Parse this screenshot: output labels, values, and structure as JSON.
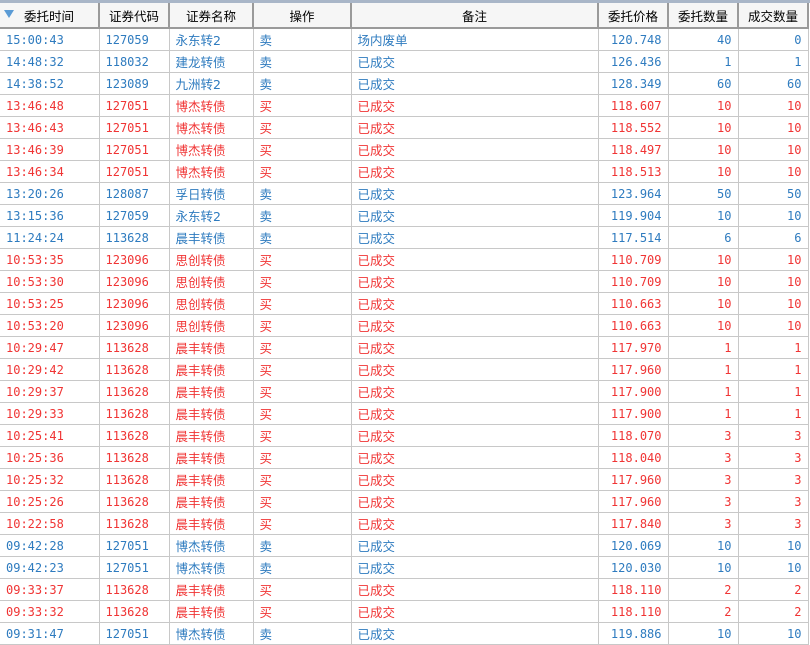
{
  "colors": {
    "sell": "#2e7bbf",
    "buy": "#f03434"
  },
  "headers": [
    "委托时间",
    "证券代码",
    "证券名称",
    "操作",
    "备注",
    "委托价格",
    "委托数量",
    "成交数量"
  ],
  "rows": [
    [
      "15:00:43",
      "127059",
      "永东转2",
      "卖",
      "场内废单",
      "120.748",
      "40",
      "0",
      "sell"
    ],
    [
      "14:48:32",
      "118032",
      "建龙转债",
      "卖",
      "已成交",
      "126.436",
      "1",
      "1",
      "sell"
    ],
    [
      "14:38:52",
      "123089",
      "九洲转2",
      "卖",
      "已成交",
      "128.349",
      "60",
      "60",
      "sell"
    ],
    [
      "13:46:48",
      "127051",
      "博杰转债",
      "买",
      "已成交",
      "118.607",
      "10",
      "10",
      "buy"
    ],
    [
      "13:46:43",
      "127051",
      "博杰转债",
      "买",
      "已成交",
      "118.552",
      "10",
      "10",
      "buy"
    ],
    [
      "13:46:39",
      "127051",
      "博杰转债",
      "买",
      "已成交",
      "118.497",
      "10",
      "10",
      "buy"
    ],
    [
      "13:46:34",
      "127051",
      "博杰转债",
      "买",
      "已成交",
      "118.513",
      "10",
      "10",
      "buy"
    ],
    [
      "13:20:26",
      "128087",
      "孚日转债",
      "卖",
      "已成交",
      "123.964",
      "50",
      "50",
      "sell"
    ],
    [
      "13:15:36",
      "127059",
      "永东转2",
      "卖",
      "已成交",
      "119.904",
      "10",
      "10",
      "sell"
    ],
    [
      "11:24:24",
      "113628",
      "晨丰转债",
      "卖",
      "已成交",
      "117.514",
      "6",
      "6",
      "sell"
    ],
    [
      "10:53:35",
      "123096",
      "思创转债",
      "买",
      "已成交",
      "110.709",
      "10",
      "10",
      "buy"
    ],
    [
      "10:53:30",
      "123096",
      "思创转债",
      "买",
      "已成交",
      "110.709",
      "10",
      "10",
      "buy"
    ],
    [
      "10:53:25",
      "123096",
      "思创转债",
      "买",
      "已成交",
      "110.663",
      "10",
      "10",
      "buy"
    ],
    [
      "10:53:20",
      "123096",
      "思创转债",
      "买",
      "已成交",
      "110.663",
      "10",
      "10",
      "buy"
    ],
    [
      "10:29:47",
      "113628",
      "晨丰转债",
      "买",
      "已成交",
      "117.970",
      "1",
      "1",
      "buy"
    ],
    [
      "10:29:42",
      "113628",
      "晨丰转债",
      "买",
      "已成交",
      "117.960",
      "1",
      "1",
      "buy"
    ],
    [
      "10:29:37",
      "113628",
      "晨丰转债",
      "买",
      "已成交",
      "117.900",
      "1",
      "1",
      "buy"
    ],
    [
      "10:29:33",
      "113628",
      "晨丰转债",
      "买",
      "已成交",
      "117.900",
      "1",
      "1",
      "buy"
    ],
    [
      "10:25:41",
      "113628",
      "晨丰转债",
      "买",
      "已成交",
      "118.070",
      "3",
      "3",
      "buy"
    ],
    [
      "10:25:36",
      "113628",
      "晨丰转债",
      "买",
      "已成交",
      "118.040",
      "3",
      "3",
      "buy"
    ],
    [
      "10:25:32",
      "113628",
      "晨丰转债",
      "买",
      "已成交",
      "117.960",
      "3",
      "3",
      "buy"
    ],
    [
      "10:25:26",
      "113628",
      "晨丰转债",
      "买",
      "已成交",
      "117.960",
      "3",
      "3",
      "buy"
    ],
    [
      "10:22:58",
      "113628",
      "晨丰转债",
      "买",
      "已成交",
      "117.840",
      "3",
      "3",
      "buy"
    ],
    [
      "09:42:28",
      "127051",
      "博杰转债",
      "卖",
      "已成交",
      "120.069",
      "10",
      "10",
      "sell"
    ],
    [
      "09:42:23",
      "127051",
      "博杰转债",
      "卖",
      "已成交",
      "120.030",
      "10",
      "10",
      "sell"
    ],
    [
      "09:33:37",
      "113628",
      "晨丰转债",
      "买",
      "已成交",
      "118.110",
      "2",
      "2",
      "buy"
    ],
    [
      "09:33:32",
      "113628",
      "晨丰转债",
      "买",
      "已成交",
      "118.110",
      "2",
      "2",
      "buy"
    ],
    [
      "09:31:47",
      "127051",
      "博杰转债",
      "卖",
      "已成交",
      "119.886",
      "10",
      "10",
      "sell"
    ]
  ]
}
